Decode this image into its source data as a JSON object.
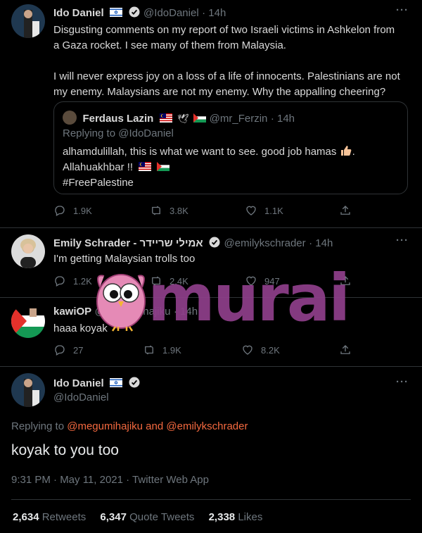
{
  "tweet1": {
    "name": "Ido Daniel",
    "handle": "@IdoDaniel",
    "time": "· 14h",
    "line1": "Disgusting comments on my report of two Israeli victims in Ashkelon from",
    "line2": "a Gaza rocket. I see many of them from Malaysia.",
    "line3": "I will never express joy on a loss of a life of innocents. Palestinians are not",
    "line4": "my enemy. Malaysians are not my enemy. Why the appalling cheering?",
    "quote": {
      "name": "Ferdaus Lazin",
      "handle": "@mr_Ferzin",
      "time": "· 14h",
      "replying_label": "Replying to",
      "replying_to": "@IdoDaniel",
      "line1": "alhamdulillah, this is what we want to see. good job hamas",
      "line2": "Allahuakhbar !!",
      "line3": "#FreePalestine"
    },
    "replies": "1.9K",
    "retweets": "3.8K",
    "likes": "1.1K"
  },
  "tweet2": {
    "name": "Emily Schrader - אמילי שריידר",
    "handle": "@emilykschrader",
    "time": "· 14h",
    "text": "I'm getting Malaysian trolls too",
    "replies": "1.2K",
    "retweets": "2.4K",
    "likes": "947"
  },
  "tweet3": {
    "name": "kawiOP",
    "handle": "@megumihajiku",
    "time": "· 14h",
    "text": "haaa koyak",
    "replies": "27",
    "retweets": "1.9K",
    "likes": "8.2K"
  },
  "main": {
    "name": "Ido Daniel",
    "handle": "@IdoDaniel",
    "replying_label": "Replying to",
    "replying_1": "@megumihajiku",
    "replying_and": "and",
    "replying_2": "@emilykschrader",
    "text": "koyak to you too",
    "meta": "9:31 PM · May 11, 2021 · Twitter Web App",
    "retweets_count": "2,634",
    "retweets_label": "Retweets",
    "quotes_count": "6,347",
    "quotes_label": "Quote Tweets",
    "likes_count": "2,338",
    "likes_label": "Likes"
  },
  "watermark": {
    "text": "murai"
  },
  "colors": {
    "accent": "#1d9bf0",
    "link": "#f4693f",
    "watermark": "#8e3f8a",
    "bird": "#e58ab6"
  }
}
